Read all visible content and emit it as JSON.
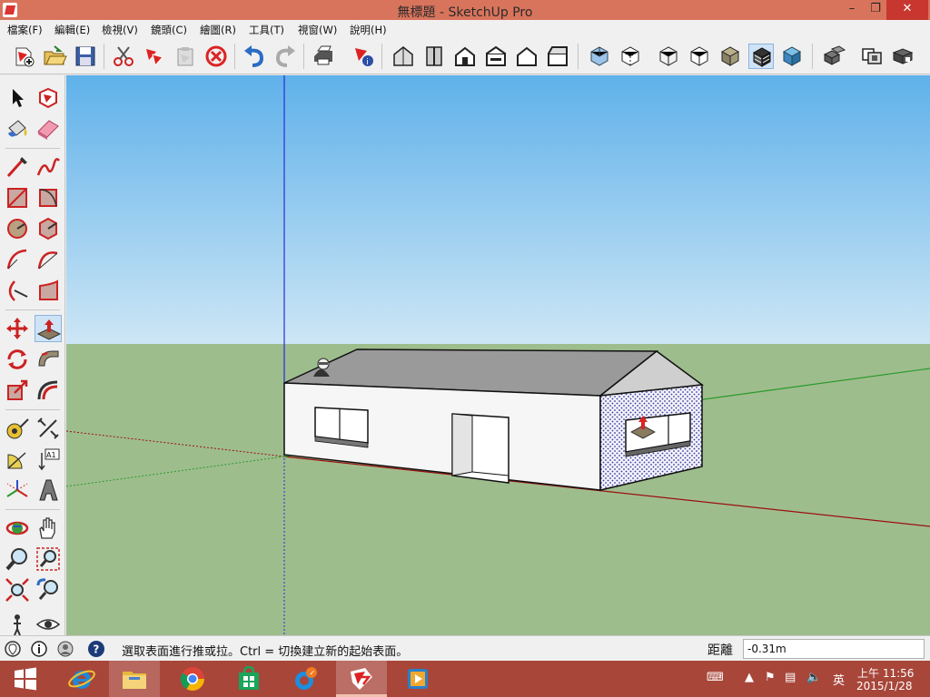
{
  "window": {
    "title": "無標題 - SketchUp Pro",
    "minimize": "–",
    "maximize": "❐",
    "close": "✕"
  },
  "menu": [
    "檔案(F)",
    "編輯(E)",
    "檢視(V)",
    "鏡頭(C)",
    "繪圖(R)",
    "工具(T)",
    "視窗(W)",
    "說明(H)"
  ],
  "toolbar": {
    "icons": [
      "new-file-icon",
      "open-folder-icon",
      "save-icon",
      "cut-icon",
      "copy-icon",
      "paste-icon",
      "erase-icon",
      "undo-icon",
      "redo-icon",
      "print-icon",
      "model-info-icon",
      "iso-view-icon",
      "top-view-icon",
      "front-view-icon",
      "right-view-icon",
      "back-view-icon",
      "left-view-icon",
      "xray-icon",
      "back-edges-icon",
      "wireframe-icon",
      "hidden-line-icon",
      "shaded-icon",
      "shaded-textures-icon",
      "monochrome-icon",
      "component-icon",
      "group-icon",
      "section-icon"
    ]
  },
  "palette": {
    "tools": [
      "select-tool",
      "make-component-tool",
      "paint-bucket-tool",
      "eraser-tool",
      "line-tool",
      "freehand-tool",
      "rectangle-tool",
      "rotated-rectangle-tool",
      "circle-tool",
      "polygon-tool",
      "arc-tool",
      "two-point-arc-tool",
      "three-point-arc-tool",
      "pie-tool",
      "move-tool",
      "push-pull-tool",
      "rotate-tool",
      "follow-me-tool",
      "scale-tool",
      "offset-tool",
      "tape-measure-tool",
      "dimension-tool",
      "protractor-tool",
      "text-tool",
      "axes-tool",
      "3d-text-tool",
      "orbit-tool",
      "pan-tool",
      "zoom-tool",
      "zoom-window-tool",
      "zoom-extents-tool",
      "previous-view-tool",
      "walk-tool",
      "look-around-tool"
    ],
    "active_tool": "push-pull-tool"
  },
  "status": {
    "hint": "選取表面進行推或拉。Ctrl = 切換建立新的起始表面。",
    "measure_label": "距離",
    "measure_value": "-0.31m"
  },
  "taskbar": {
    "apps": [
      "start-button",
      "internet-explorer",
      "file-explorer",
      "chrome",
      "store",
      "browser-app",
      "sketchup",
      "media-app"
    ],
    "active_app": "sketchup",
    "ime": "英",
    "time": "上午 11:56",
    "date": "2015/1/28"
  },
  "colors": {
    "sky_top": "#5aaee8",
    "sky_bottom": "#cde6f5",
    "ground": "#9ebd8d",
    "titlebar": "#d9745c",
    "taskbar": "#a8463a"
  }
}
